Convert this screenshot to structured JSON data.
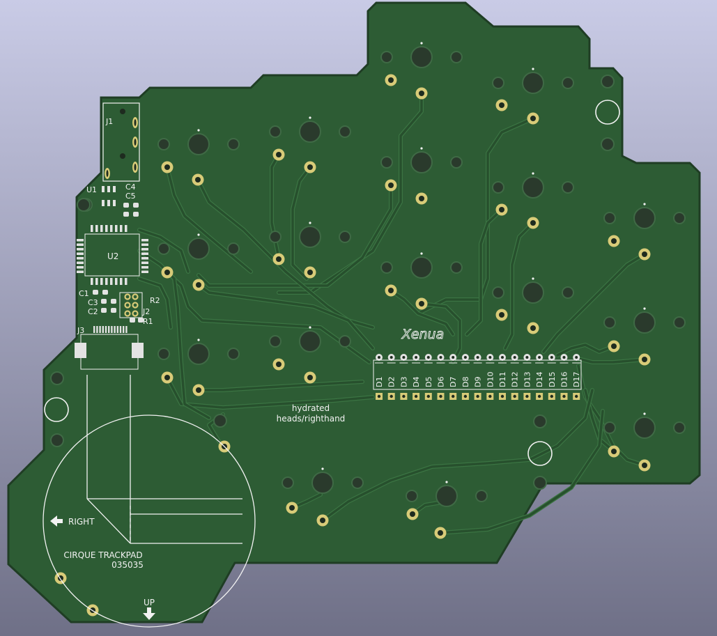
{
  "colors": {
    "bg_top": "#c9cbe6",
    "bg_bottom": "#6f7087",
    "board": "#2d5c34",
    "board_edge": "#1f3d24",
    "trace": "#27502d",
    "trace_edge": "#3b7443",
    "silk": "#f2f2f2",
    "pad_gold": "#d8cb78",
    "pad_silver": "#e3e3e3",
    "hole": "#1e2b1f"
  },
  "board": {
    "project_line1": "hydrated",
    "project_line2": "heads/righthand",
    "logo": "Xenua"
  },
  "trackpad": {
    "label_line1": "CIRQUE TRACKPAD",
    "label_line2": "035035",
    "right_label": "RIGHT",
    "up_label": "UP"
  },
  "designators": {
    "j1": "J1",
    "u1": "U1",
    "c4": "C4",
    "c5": "C5",
    "u2": "U2",
    "c1": "C1",
    "c3": "C3",
    "c2": "C2",
    "r2": "R2",
    "j2": "J2",
    "r1": "R1",
    "j3": "J3"
  },
  "diodes": [
    "D1",
    "D2",
    "D3",
    "D4",
    "D5",
    "D6",
    "D7",
    "D8",
    "D9",
    "D10",
    "D11",
    "D12",
    "D13",
    "D14",
    "D15",
    "D16",
    "D17"
  ],
  "icons": [
    "arrow-left-icon",
    "arrow-down-icon"
  ]
}
